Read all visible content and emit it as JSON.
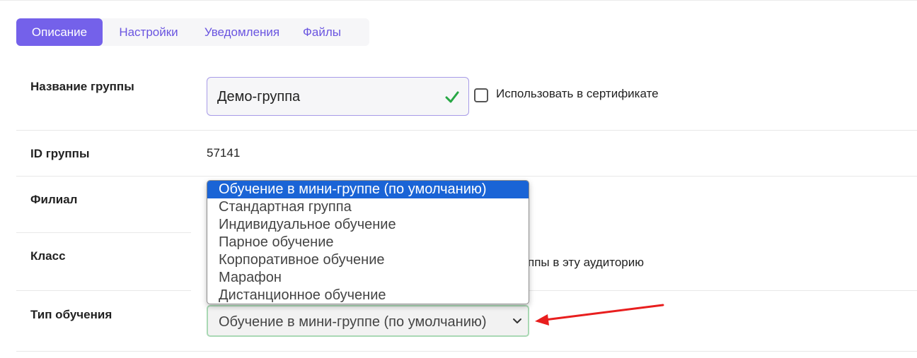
{
  "tabs": [
    {
      "label": "Описание",
      "active": true
    },
    {
      "label": "Настройки",
      "active": false
    },
    {
      "label": "Уведомления",
      "active": false
    },
    {
      "label": "Файлы",
      "active": false
    }
  ],
  "rows": {
    "group_name": {
      "label": "Название группы",
      "value": "Демо-группа"
    },
    "certificate": {
      "label": "Использовать в сертификате",
      "checked": false
    },
    "group_id": {
      "label": "ID группы",
      "value": "57141"
    },
    "branch": {
      "label": "Филиал"
    },
    "class": {
      "label": "Класс",
      "hint_fragment": "ппы в эту аудиторию"
    },
    "training_type": {
      "label": "Тип обучения",
      "value": "Обучение в мини-группе (по умолчанию)"
    }
  },
  "dropdown": {
    "options": [
      "Обучение в мини-группе (по умолчанию)",
      "Стандартная группа",
      "Индивидуальное обучение",
      "Парное обучение",
      "Корпоративное обучение",
      "Марафон",
      "Дистанционное обучение"
    ],
    "selected_index": 0
  },
  "colors": {
    "accent": "#7461ea",
    "tab_text": "#6a55e0",
    "dropdown_highlight": "#1a64d6",
    "check_green": "#28a745",
    "arrow_red": "#e81e1e"
  },
  "icons": {
    "valid": "check-icon",
    "select": "chevron-down-icon",
    "annotation": "red-arrow-icon"
  }
}
